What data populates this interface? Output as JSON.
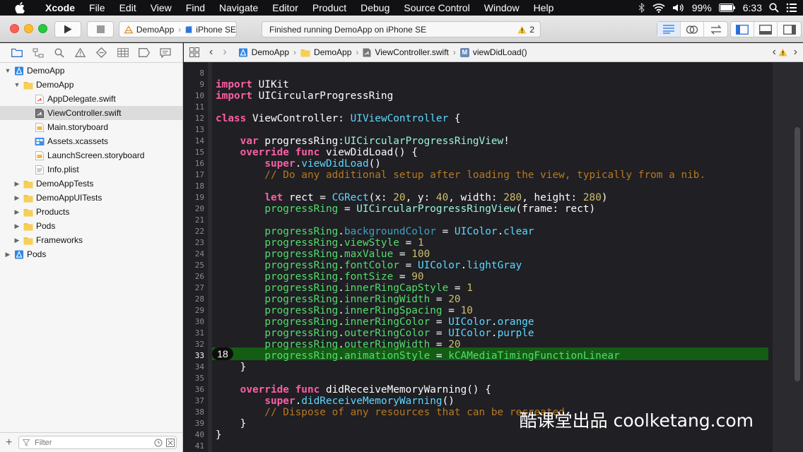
{
  "menubar": {
    "app": "Xcode",
    "items": [
      "File",
      "Edit",
      "View",
      "Find",
      "Navigate",
      "Editor",
      "Product",
      "Debug",
      "Source Control",
      "Window",
      "Help"
    ],
    "battery": "99%",
    "time": "6:33"
  },
  "toolbar": {
    "scheme_target": "DemoApp",
    "scheme_device": "iPhone SE",
    "status": "Finished running DemoApp on iPhone SE",
    "warning_count": "2"
  },
  "navigator": {
    "items": [
      {
        "label": "DemoApp",
        "type": "project",
        "expanded": true
      },
      {
        "label": "DemoApp",
        "type": "folder",
        "expanded": true
      },
      {
        "label": "AppDelegate.swift",
        "type": "swift"
      },
      {
        "label": "ViewController.swift",
        "type": "swift",
        "selected": true
      },
      {
        "label": "Main.storyboard",
        "type": "storyboard"
      },
      {
        "label": "Assets.xcassets",
        "type": "assets"
      },
      {
        "label": "LaunchScreen.storyboard",
        "type": "storyboard"
      },
      {
        "label": "Info.plist",
        "type": "plist"
      },
      {
        "label": "DemoAppTests",
        "type": "folder",
        "expanded": false
      },
      {
        "label": "DemoAppUITests",
        "type": "folder",
        "expanded": false
      },
      {
        "label": "Products",
        "type": "folder",
        "expanded": false
      },
      {
        "label": "Pods",
        "type": "folder",
        "expanded": false
      },
      {
        "label": "Frameworks",
        "type": "folder",
        "expanded": false
      },
      {
        "label": "Pods",
        "type": "project",
        "expanded": false
      }
    ],
    "filter_placeholder": "Filter"
  },
  "jumpbar": {
    "crumbs": [
      "DemoApp",
      "DemoApp",
      "ViewController.swift",
      "viewDidLoad()"
    ]
  },
  "editor": {
    "line_numbers": [
      "8",
      "9",
      "10",
      "11",
      "12",
      "13",
      "14",
      "15",
      "16",
      "17",
      "18",
      "19",
      "20",
      "21",
      "22",
      "23",
      "24",
      "25",
      "26",
      "27",
      "28",
      "29",
      "30",
      "31",
      "32",
      "33",
      "34",
      "35",
      "36",
      "37",
      "38",
      "39",
      "40",
      "41"
    ],
    "breakpoint_label": "18",
    "lines": {
      "l9": [
        {
          "t": "import",
          "c": "kw"
        },
        {
          "t": " UIKit",
          "c": ""
        }
      ],
      "l10": [
        {
          "t": "import",
          "c": "kw"
        },
        {
          "t": " UICircularProgressRing",
          "c": ""
        }
      ],
      "l12": [
        {
          "t": "class",
          "c": "kw"
        },
        {
          "t": " ViewController: ",
          "c": ""
        },
        {
          "t": "UIViewController",
          "c": "ty"
        },
        {
          "t": " {",
          "c": ""
        }
      ],
      "l14": [
        {
          "t": "    ",
          "c": ""
        },
        {
          "t": "var",
          "c": "kw"
        },
        {
          "t": " progressRing:",
          "c": ""
        },
        {
          "t": "UICircularProgressRingView",
          "c": "cls"
        },
        {
          "t": "!",
          "c": ""
        }
      ],
      "l15": [
        {
          "t": "    ",
          "c": ""
        },
        {
          "t": "override",
          "c": "kw"
        },
        {
          "t": " ",
          "c": ""
        },
        {
          "t": "func",
          "c": "kw"
        },
        {
          "t": " viewDidLoad() {",
          "c": ""
        }
      ],
      "l16": [
        {
          "t": "        ",
          "c": ""
        },
        {
          "t": "super",
          "c": "kw"
        },
        {
          "t": ".",
          "c": ""
        },
        {
          "t": "viewDidLoad",
          "c": "ty"
        },
        {
          "t": "()",
          "c": ""
        }
      ],
      "l17": [
        {
          "t": "        // Do any additional setup after loading the view, typically from a nib.",
          "c": "cm"
        }
      ],
      "l19": [
        {
          "t": "        ",
          "c": ""
        },
        {
          "t": "let",
          "c": "kw"
        },
        {
          "t": " rect = ",
          "c": ""
        },
        {
          "t": "CGRect",
          "c": "ty"
        },
        {
          "t": "(x: ",
          "c": ""
        },
        {
          "t": "20",
          "c": "num"
        },
        {
          "t": ", y: ",
          "c": ""
        },
        {
          "t": "40",
          "c": "num"
        },
        {
          "t": ", width: ",
          "c": ""
        },
        {
          "t": "280",
          "c": "num"
        },
        {
          "t": ", height: ",
          "c": ""
        },
        {
          "t": "280",
          "c": "num"
        },
        {
          "t": ")",
          "c": ""
        }
      ],
      "l20": [
        {
          "t": "        ",
          "c": ""
        },
        {
          "t": "progressRing",
          "c": "prj"
        },
        {
          "t": " = ",
          "c": ""
        },
        {
          "t": "UICircularProgressRingView",
          "c": "cls"
        },
        {
          "t": "(frame: rect)",
          "c": ""
        }
      ],
      "l22": [
        {
          "t": "        ",
          "c": ""
        },
        {
          "t": "progressRing",
          "c": "prj"
        },
        {
          "t": ".",
          "c": ""
        },
        {
          "t": "backgroundColor",
          "c": "pr"
        },
        {
          "t": " = ",
          "c": ""
        },
        {
          "t": "UIColor",
          "c": "ty"
        },
        {
          "t": ".",
          "c": ""
        },
        {
          "t": "clear",
          "c": "ty"
        }
      ],
      "l23": [
        {
          "t": "        ",
          "c": ""
        },
        {
          "t": "progressRing",
          "c": "prj"
        },
        {
          "t": ".",
          "c": ""
        },
        {
          "t": "viewStyle",
          "c": "prj"
        },
        {
          "t": " = ",
          "c": ""
        },
        {
          "t": "1",
          "c": "num"
        }
      ],
      "l24": [
        {
          "t": "        ",
          "c": ""
        },
        {
          "t": "progressRing",
          "c": "prj"
        },
        {
          "t": ".",
          "c": ""
        },
        {
          "t": "maxValue",
          "c": "prj"
        },
        {
          "t": " = ",
          "c": ""
        },
        {
          "t": "100",
          "c": "num"
        }
      ],
      "l25": [
        {
          "t": "        ",
          "c": ""
        },
        {
          "t": "progressRing",
          "c": "prj"
        },
        {
          "t": ".",
          "c": ""
        },
        {
          "t": "fontColor",
          "c": "prj"
        },
        {
          "t": " = ",
          "c": ""
        },
        {
          "t": "UIColor",
          "c": "ty"
        },
        {
          "t": ".",
          "c": ""
        },
        {
          "t": "lightGray",
          "c": "ty"
        }
      ],
      "l26": [
        {
          "t": "        ",
          "c": ""
        },
        {
          "t": "progressRing",
          "c": "prj"
        },
        {
          "t": ".",
          "c": ""
        },
        {
          "t": "fontSize",
          "c": "prj"
        },
        {
          "t": " = ",
          "c": ""
        },
        {
          "t": "90",
          "c": "num"
        }
      ],
      "l27": [
        {
          "t": "        ",
          "c": ""
        },
        {
          "t": "progressRing",
          "c": "prj"
        },
        {
          "t": ".",
          "c": ""
        },
        {
          "t": "innerRingCapStyle",
          "c": "prj"
        },
        {
          "t": " = ",
          "c": ""
        },
        {
          "t": "1",
          "c": "num"
        }
      ],
      "l28": [
        {
          "t": "        ",
          "c": ""
        },
        {
          "t": "progressRing",
          "c": "prj"
        },
        {
          "t": ".",
          "c": ""
        },
        {
          "t": "innerRingWidth",
          "c": "prj"
        },
        {
          "t": " = ",
          "c": ""
        },
        {
          "t": "20",
          "c": "num"
        }
      ],
      "l29": [
        {
          "t": "        ",
          "c": ""
        },
        {
          "t": "progressRing",
          "c": "prj"
        },
        {
          "t": ".",
          "c": ""
        },
        {
          "t": "innerRingSpacing",
          "c": "prj"
        },
        {
          "t": " = ",
          "c": ""
        },
        {
          "t": "10",
          "c": "num"
        }
      ],
      "l30": [
        {
          "t": "        ",
          "c": ""
        },
        {
          "t": "progressRing",
          "c": "prj"
        },
        {
          "t": ".",
          "c": ""
        },
        {
          "t": "innerRingColor",
          "c": "prj"
        },
        {
          "t": " = ",
          "c": ""
        },
        {
          "t": "UIColor",
          "c": "ty"
        },
        {
          "t": ".",
          "c": ""
        },
        {
          "t": "orange",
          "c": "ty"
        }
      ],
      "l31": [
        {
          "t": "        ",
          "c": ""
        },
        {
          "t": "progressRing",
          "c": "prj"
        },
        {
          "t": ".",
          "c": ""
        },
        {
          "t": "outerRingColor",
          "c": "prj"
        },
        {
          "t": " = ",
          "c": ""
        },
        {
          "t": "UIColor",
          "c": "ty"
        },
        {
          "t": ".",
          "c": ""
        },
        {
          "t": "purple",
          "c": "ty"
        }
      ],
      "l32": [
        {
          "t": "        ",
          "c": ""
        },
        {
          "t": "progressRing",
          "c": "prj"
        },
        {
          "t": ".",
          "c": ""
        },
        {
          "t": "outerRingWidth",
          "c": "prj"
        },
        {
          "t": " = ",
          "c": ""
        },
        {
          "t": "20",
          "c": "num"
        }
      ],
      "l33": [
        {
          "t": "        ",
          "c": ""
        },
        {
          "t": "progressRing",
          "c": "prj"
        },
        {
          "t": ".",
          "c": ""
        },
        {
          "t": "animationStyle",
          "c": "prj"
        },
        {
          "t": " = ",
          "c": ""
        },
        {
          "t": "kCAMediaTimingFunctionLinear",
          "c": "prj"
        }
      ],
      "l34": [
        {
          "t": "    }",
          "c": ""
        }
      ],
      "l36": [
        {
          "t": "    ",
          "c": ""
        },
        {
          "t": "override",
          "c": "kw"
        },
        {
          "t": " ",
          "c": ""
        },
        {
          "t": "func",
          "c": "kw"
        },
        {
          "t": " didReceiveMemoryWarning() {",
          "c": ""
        }
      ],
      "l37": [
        {
          "t": "        ",
          "c": ""
        },
        {
          "t": "super",
          "c": "kw"
        },
        {
          "t": ".",
          "c": ""
        },
        {
          "t": "didReceiveMemoryWarning",
          "c": "ty"
        },
        {
          "t": "()",
          "c": ""
        }
      ],
      "l38": [
        {
          "t": "        // Dispose of any resources that can be recreated.",
          "c": "cm"
        }
      ],
      "l39": [
        {
          "t": "    }",
          "c": ""
        }
      ],
      "l40": [
        {
          "t": "}",
          "c": ""
        }
      ]
    }
  },
  "watermark": "酷课堂出品 coolketang.com",
  "colors": {
    "editor_bg": "#1f1f24",
    "keyword": "#fc5fa3",
    "type": "#5dd8ff",
    "comment": "#b8781f",
    "number": "#d0bf69",
    "project": "#53dd6a",
    "highlight": "#145d14"
  }
}
